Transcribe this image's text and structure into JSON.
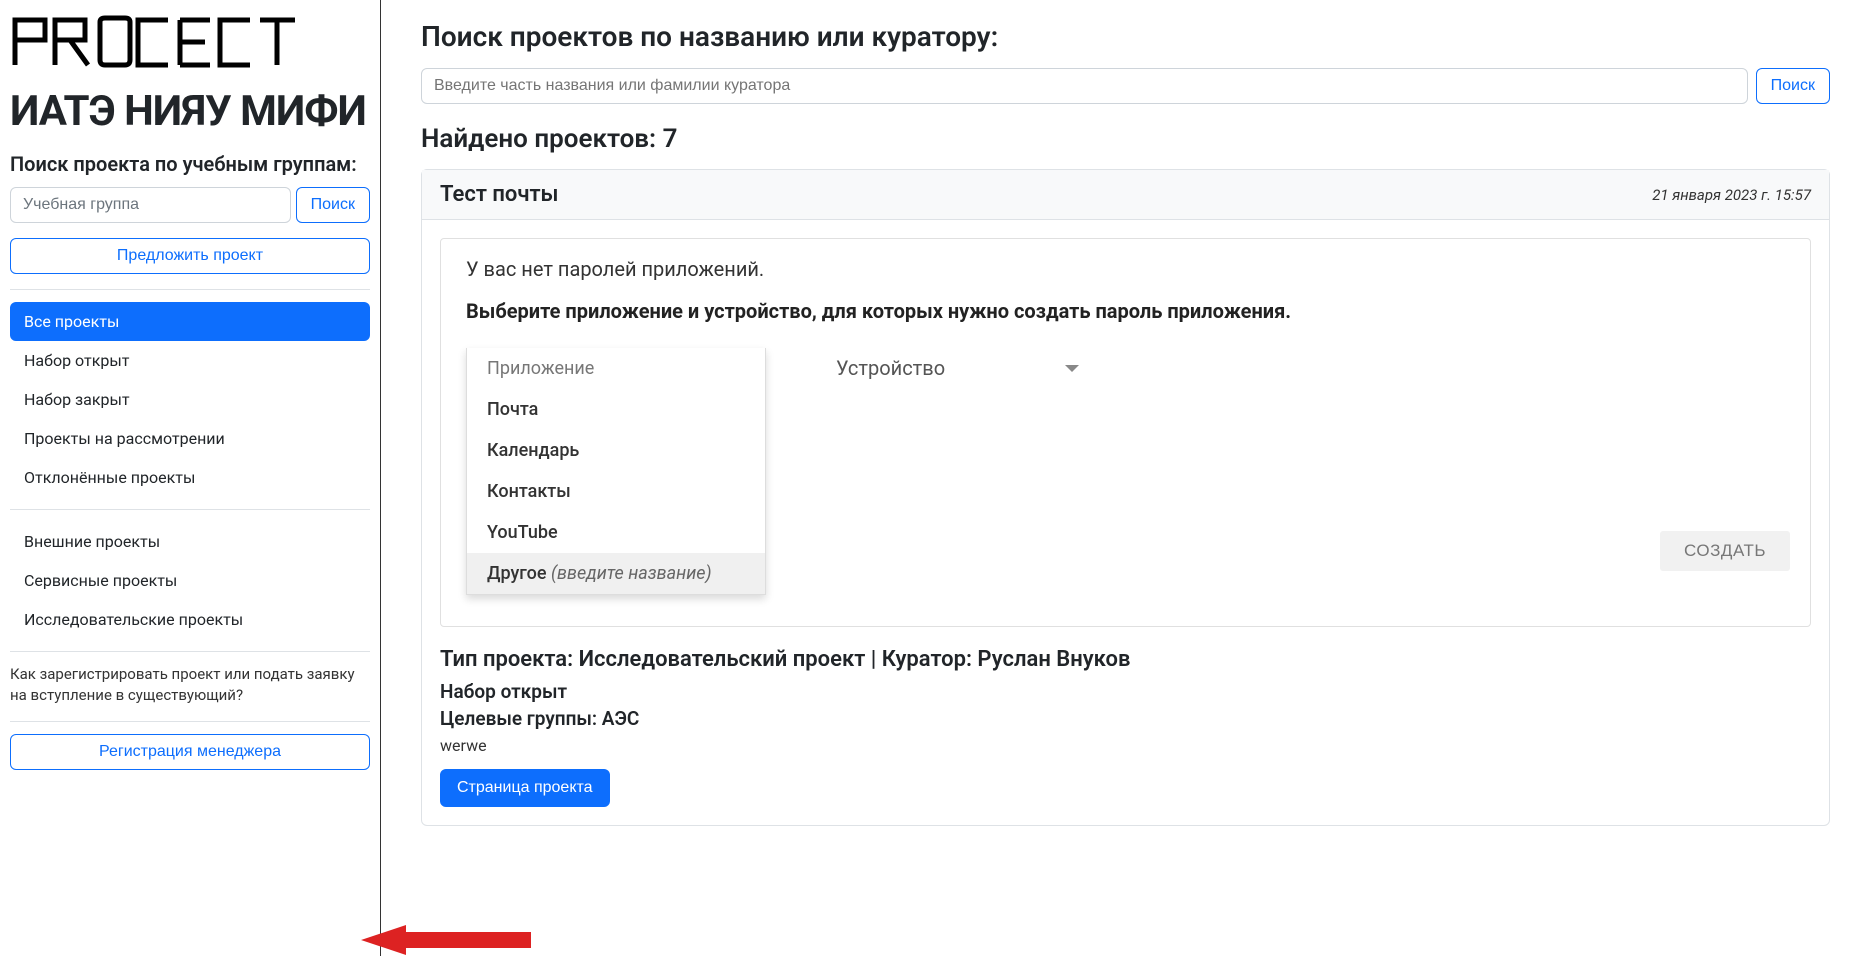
{
  "sidebar": {
    "logo_top": "PROJECT",
    "logo_bottom": "ИАТЭ НИЯУ МИФИ",
    "search_heading": "Поиск проекта по учебным группам:",
    "group_placeholder": "Учебная группа",
    "search_btn": "Поиск",
    "propose_btn": "Предложить проект",
    "nav1": [
      {
        "label": "Все проекты",
        "active": true
      },
      {
        "label": "Набор открыт",
        "active": false
      },
      {
        "label": "Набор закрыт",
        "active": false
      },
      {
        "label": "Проекты на рассмотрении",
        "active": false
      },
      {
        "label": "Отклонённые проекты",
        "active": false
      }
    ],
    "nav2": [
      {
        "label": "Внешние проекты"
      },
      {
        "label": "Сервисные проекты"
      },
      {
        "label": "Исследовательские проекты"
      }
    ],
    "help": "Как зарегистрировать проект или подать заявку на вступление в существующий?",
    "register_btn": "Регистрация менеджера"
  },
  "main": {
    "search_heading": "Поиск проектов по названию или куратору:",
    "search_placeholder": "Введите часть названия или фамилии куратора",
    "search_btn": "Поиск",
    "results_heading": "Найдено проектов: 7",
    "card": {
      "title": "Тест почты",
      "date": "21 января 2023 г. 15:57",
      "panel": {
        "no_passwords": "У вас нет паролей приложений.",
        "instruction": "Выберите приложение и устройство, для которых нужно создать пароль приложения.",
        "app_label": "Приложение",
        "options": [
          "Почта",
          "Календарь",
          "Контакты",
          "YouTube"
        ],
        "other_label": "Другое",
        "other_hint": "(введите название)",
        "device_label": "Устройство",
        "create_btn": "СОЗДАТЬ"
      },
      "meta": "Тип проекта: Исследовательский проект | Куратор: Руслан Внуков",
      "status": "Набор открыт",
      "groups": "Целевые группы: АЭС",
      "desc": "werwe",
      "page_btn": "Страница проекта"
    }
  }
}
